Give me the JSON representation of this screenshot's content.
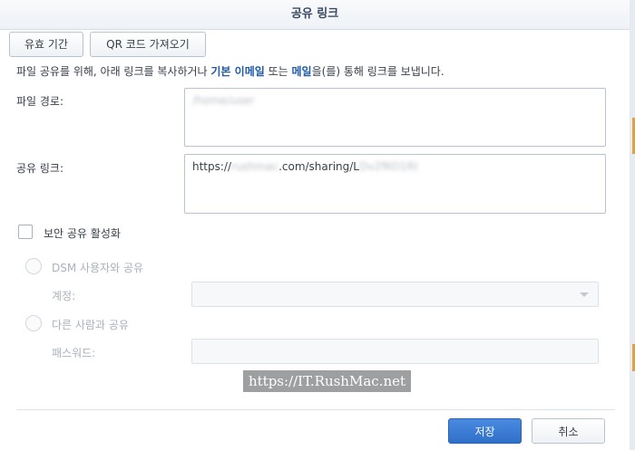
{
  "dialog": {
    "title": "공유 링크"
  },
  "toolbar": {
    "validity_label": "유효 기간",
    "qr_label": "QR 코드 가져오기"
  },
  "description": {
    "prefix": "파일 공유를 위해, 아래 링크를 복사하거나 ",
    "email_basic": "기본 이메일",
    "middle": " 또는 ",
    "mail": "메일",
    "suffix": "을(를) 통해 링크를 보냅니다."
  },
  "file_path": {
    "label": "파일 경로:",
    "value": "/home/user"
  },
  "share_link": {
    "label": "공유 링크:",
    "value_prefix": "https://",
    "value_blurred_host": "rushmac",
    "value_mid": ".com/sharing/L",
    "value_blurred_id": "Dv2fKO1RI"
  },
  "secure_share": {
    "label": "보안 공유 활성화"
  },
  "dsm_share": {
    "label": "DSM 사용자와 공유",
    "account_label": "계정:",
    "account_value": ""
  },
  "others_share": {
    "label": "다른 사람과 공유",
    "password_label": "패스워드:",
    "password_value": ""
  },
  "watermark": {
    "text": "https://IT.RushMac.net"
  },
  "footer": {
    "save_label": "저장",
    "cancel_label": "취소"
  }
}
